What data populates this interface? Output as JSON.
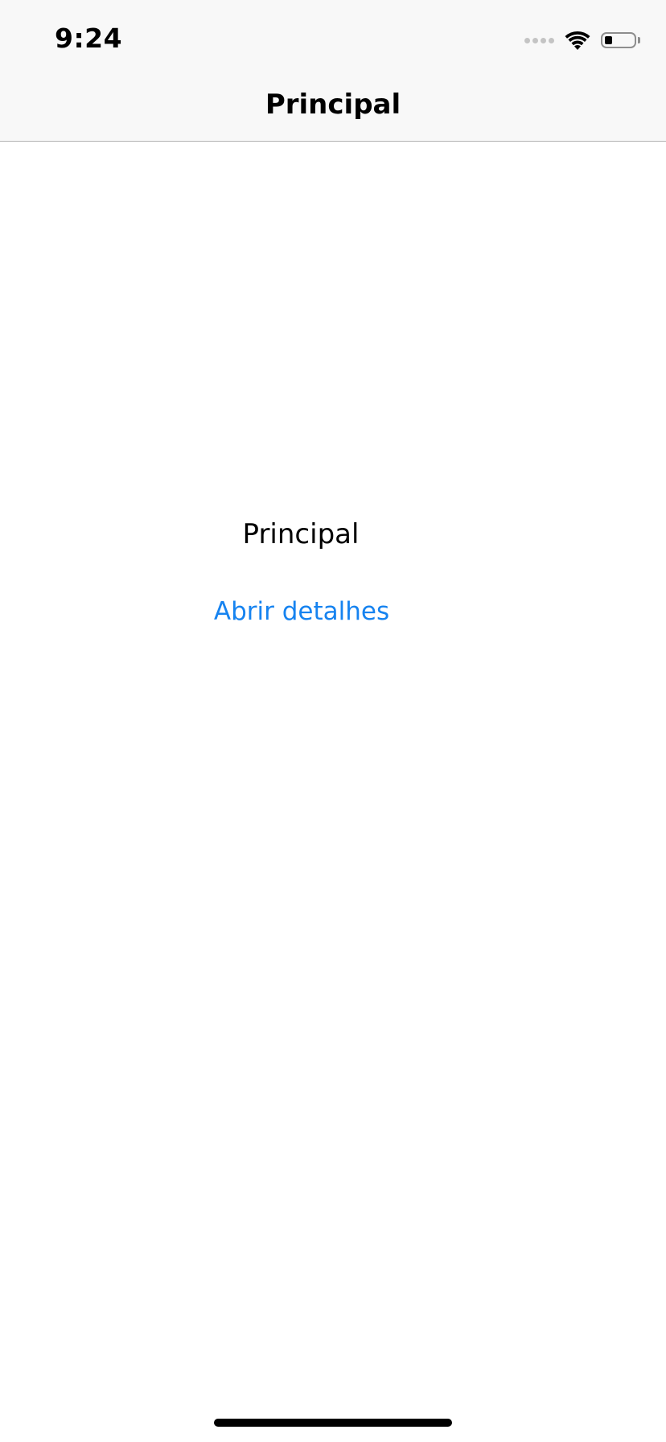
{
  "status_bar": {
    "time": "9:24",
    "battery_level": 0.25
  },
  "nav_bar": {
    "title": "Principal"
  },
  "main": {
    "label": "Principal",
    "details_link": "Abrir detalhes"
  },
  "colors": {
    "accent": "#1683f0",
    "nav_background": "#f8f8f8",
    "separator": "#b2b2b2"
  }
}
